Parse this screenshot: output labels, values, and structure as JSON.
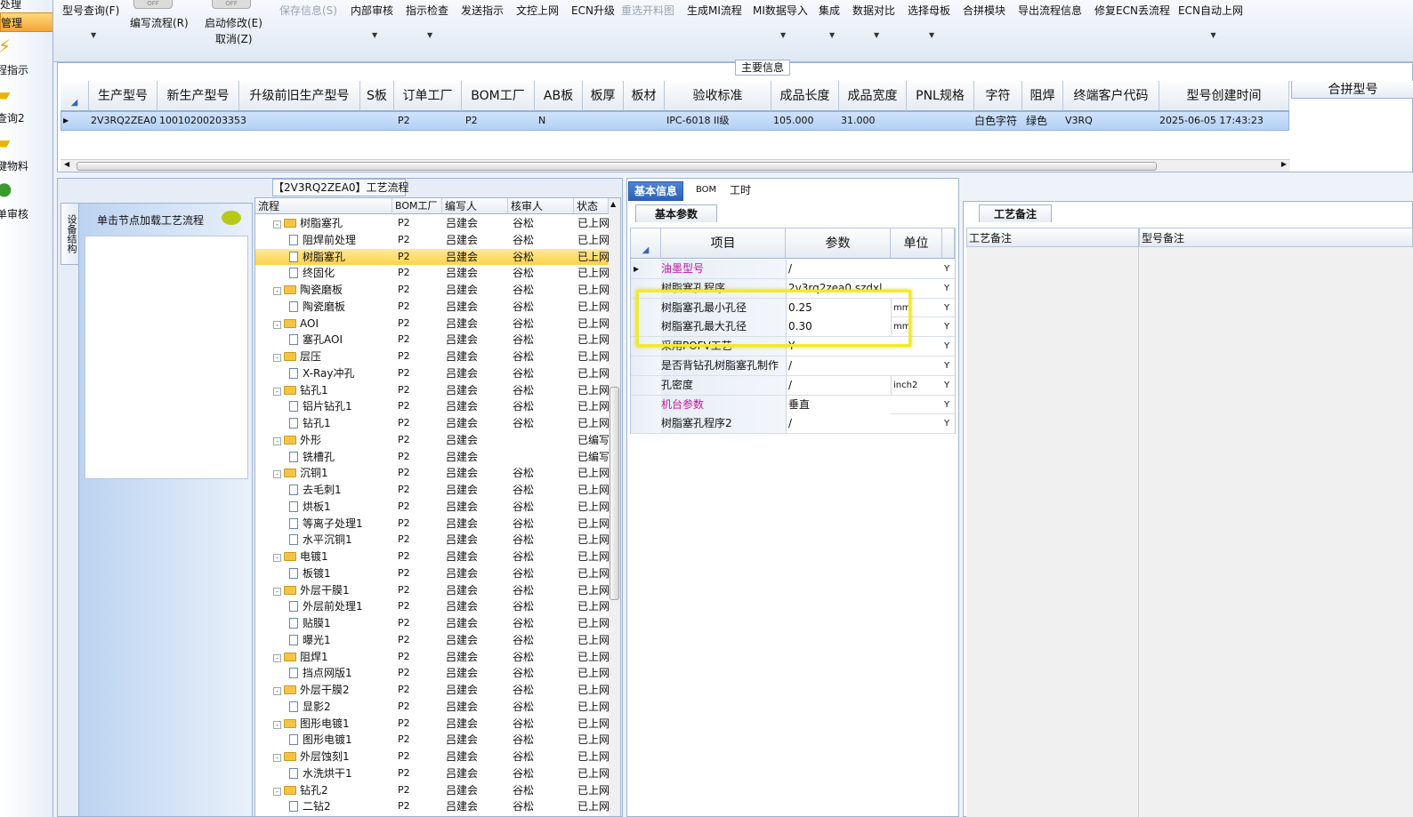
{
  "left_nav": {
    "top_item": "处理",
    "selected_item": "管理",
    "items": [
      "程指示",
      "查询2",
      "键物料",
      "单审核"
    ]
  },
  "toolbar": {
    "items": [
      {
        "label": "型号查询(F)",
        "enabled": true
      },
      {
        "label": "编写流程(R)",
        "enabled": true
      },
      {
        "label": "启动修改(E)",
        "enabled": true
      },
      {
        "label": "取消(Z)",
        "enabled": true
      },
      {
        "label": "保存信息(S)",
        "enabled": false
      },
      {
        "label": "内部审核",
        "enabled": true
      },
      {
        "label": "指示检查",
        "enabled": true
      },
      {
        "label": "发送指示",
        "enabled": true
      },
      {
        "label": "文控上网",
        "enabled": true
      },
      {
        "label": "ECN升级",
        "enabled": true
      },
      {
        "label": "重选开料图",
        "enabled": false
      },
      {
        "label": "生成MI流程",
        "enabled": true
      },
      {
        "label": "MI数据导入",
        "enabled": true
      },
      {
        "label": "集成",
        "enabled": true
      },
      {
        "label": "数据对比",
        "enabled": true
      },
      {
        "label": "选择母板",
        "enabled": true
      },
      {
        "label": "合拼模块",
        "enabled": true
      },
      {
        "label": "导出流程信息",
        "enabled": true
      },
      {
        "label": "修复ECN丢流程",
        "enabled": true
      },
      {
        "label": "ECN自动上网",
        "enabled": true
      }
    ],
    "toggle_label": "OFF"
  },
  "main_info": {
    "title": "主要信息",
    "columns": [
      "生产型号",
      "新生产型号",
      "升级前旧生产型号",
      "S板",
      "订单工厂",
      "BOM工厂",
      "AB板",
      "板厚",
      "板材",
      "验收标准",
      "成品长度",
      "成品宽度",
      "PNL规格",
      "字符",
      "阻焊",
      "终端客户代码",
      "型号创建时间"
    ],
    "row": [
      "2V3RQ2ZEA0",
      "10010200203353",
      "",
      "",
      "P2",
      "P2",
      "N",
      "",
      "",
      "IPC-6018 II级",
      "105.000",
      "31.000",
      "",
      "白色字符",
      "绿色",
      "V3RQ",
      "2025-06-05 17:43:23"
    ],
    "right_header": "合拼型号"
  },
  "flow_panel": {
    "title": "【2V3RQ2ZEA0】工艺流程",
    "side_tab": "设备结构",
    "side_hint": "单击节点加载工艺流程",
    "columns": [
      "流程",
      "BOM工厂",
      "编写人",
      "核审人",
      "状态"
    ],
    "rows": [
      {
        "name": "树脂塞孔",
        "level": 0,
        "bom": "P2",
        "writer": "吕建会",
        "reviewer": "谷松",
        "status": "已上网"
      },
      {
        "name": "阻焊前处理",
        "level": 1,
        "bom": "P2",
        "writer": "吕建会",
        "reviewer": "谷松",
        "status": "已上网"
      },
      {
        "name": "树脂塞孔",
        "level": 1,
        "bom": "P2",
        "writer": "吕建会",
        "reviewer": "谷松",
        "status": "已上网",
        "selected": true
      },
      {
        "name": "终固化",
        "level": 1,
        "bom": "P2",
        "writer": "吕建会",
        "reviewer": "谷松",
        "status": "已上网"
      },
      {
        "name": "陶瓷磨板",
        "level": 0,
        "bom": "P2",
        "writer": "吕建会",
        "reviewer": "谷松",
        "status": "已上网"
      },
      {
        "name": "陶瓷磨板",
        "level": 1,
        "bom": "P2",
        "writer": "吕建会",
        "reviewer": "谷松",
        "status": "已上网"
      },
      {
        "name": "AOI",
        "level": 0,
        "bom": "P2",
        "writer": "吕建会",
        "reviewer": "谷松",
        "status": "已上网"
      },
      {
        "name": "塞孔AOI",
        "level": 1,
        "bom": "P2",
        "writer": "吕建会",
        "reviewer": "谷松",
        "status": "已上网"
      },
      {
        "name": "层压",
        "level": 0,
        "bom": "P2",
        "writer": "吕建会",
        "reviewer": "谷松",
        "status": "已上网"
      },
      {
        "name": "X-Ray冲孔",
        "level": 1,
        "bom": "P2",
        "writer": "吕建会",
        "reviewer": "谷松",
        "status": "已上网"
      },
      {
        "name": "钻孔1",
        "level": 0,
        "bom": "P2",
        "writer": "吕建会",
        "reviewer": "谷松",
        "status": "已上网"
      },
      {
        "name": "铝片钻孔1",
        "level": 1,
        "bom": "P2",
        "writer": "吕建会",
        "reviewer": "谷松",
        "status": "已上网"
      },
      {
        "name": "钻孔1",
        "level": 1,
        "bom": "P2",
        "writer": "吕建会",
        "reviewer": "谷松",
        "status": "已上网"
      },
      {
        "name": "外形",
        "level": 0,
        "bom": "P2",
        "writer": "吕建会",
        "reviewer": "",
        "status": "已编写"
      },
      {
        "name": "铣槽孔",
        "level": 1,
        "bom": "P2",
        "writer": "吕建会",
        "reviewer": "",
        "status": "已编写"
      },
      {
        "name": "沉铜1",
        "level": 0,
        "bom": "P2",
        "writer": "吕建会",
        "reviewer": "谷松",
        "status": "已上网"
      },
      {
        "name": "去毛刺1",
        "level": 1,
        "bom": "P2",
        "writer": "吕建会",
        "reviewer": "谷松",
        "status": "已上网"
      },
      {
        "name": "烘板1",
        "level": 1,
        "bom": "P2",
        "writer": "吕建会",
        "reviewer": "谷松",
        "status": "已上网"
      },
      {
        "name": "等离子处理1",
        "level": 1,
        "bom": "P2",
        "writer": "吕建会",
        "reviewer": "谷松",
        "status": "已上网"
      },
      {
        "name": "水平沉铜1",
        "level": 1,
        "bom": "P2",
        "writer": "吕建会",
        "reviewer": "谷松",
        "status": "已上网"
      },
      {
        "name": "电镀1",
        "level": 0,
        "bom": "P2",
        "writer": "吕建会",
        "reviewer": "谷松",
        "status": "已上网"
      },
      {
        "name": "板镀1",
        "level": 1,
        "bom": "P2",
        "writer": "吕建会",
        "reviewer": "谷松",
        "status": "已上网"
      },
      {
        "name": "外层干膜1",
        "level": 0,
        "bom": "P2",
        "writer": "吕建会",
        "reviewer": "谷松",
        "status": "已上网"
      },
      {
        "name": "外层前处理1",
        "level": 1,
        "bom": "P2",
        "writer": "吕建会",
        "reviewer": "谷松",
        "status": "已上网"
      },
      {
        "name": "贴膜1",
        "level": 1,
        "bom": "P2",
        "writer": "吕建会",
        "reviewer": "谷松",
        "status": "已上网"
      },
      {
        "name": "曝光1",
        "level": 1,
        "bom": "P2",
        "writer": "吕建会",
        "reviewer": "谷松",
        "status": "已上网"
      },
      {
        "name": "阻焊1",
        "level": 0,
        "bom": "P2",
        "writer": "吕建会",
        "reviewer": "谷松",
        "status": "已上网"
      },
      {
        "name": "挡点网版1",
        "level": 1,
        "bom": "P2",
        "writer": "吕建会",
        "reviewer": "谷松",
        "status": "已上网"
      },
      {
        "name": "外层干膜2",
        "level": 0,
        "bom": "P2",
        "writer": "吕建会",
        "reviewer": "谷松",
        "status": "已上网"
      },
      {
        "name": "显影2",
        "level": 1,
        "bom": "P2",
        "writer": "吕建会",
        "reviewer": "谷松",
        "status": "已上网"
      },
      {
        "name": "图形电镀1",
        "level": 0,
        "bom": "P2",
        "writer": "吕建会",
        "reviewer": "谷松",
        "status": "已上网"
      },
      {
        "name": "图形电镀1",
        "level": 1,
        "bom": "P2",
        "writer": "吕建会",
        "reviewer": "谷松",
        "status": "已上网"
      },
      {
        "name": "外层蚀刻1",
        "level": 0,
        "bom": "P2",
        "writer": "吕建会",
        "reviewer": "谷松",
        "status": "已上网"
      },
      {
        "name": "水洗烘干1",
        "level": 1,
        "bom": "P2",
        "writer": "吕建会",
        "reviewer": "谷松",
        "status": "已上网"
      },
      {
        "name": "钻孔2",
        "level": 0,
        "bom": "P2",
        "writer": "吕建会",
        "reviewer": "谷松",
        "status": "已上网"
      },
      {
        "name": "二钻2",
        "level": 1,
        "bom": "P2",
        "writer": "吕建会",
        "reviewer": "谷松",
        "status": "已上网"
      }
    ]
  },
  "params_panel": {
    "tabs": [
      "基本信息",
      "BOM",
      "工时"
    ],
    "subtab": "基本参数",
    "columns": [
      "项目",
      "参数",
      "单位"
    ],
    "rows": [
      {
        "item": "油墨型号",
        "value": "/",
        "unit": "",
        "flag": "Y",
        "magenta": true,
        "current": true
      },
      {
        "item": "树脂塞孔程序",
        "value": "2v3rq2zea0.szdxl",
        "unit": "",
        "flag": "Y"
      },
      {
        "item": "树脂塞孔最小孔径",
        "value": "0.25",
        "unit": "mm",
        "flag": "Y"
      },
      {
        "item": "树脂塞孔最大孔径",
        "value": "0.30",
        "unit": "mm",
        "flag": "Y"
      },
      {
        "item": "采用POFV工艺",
        "value": "Y",
        "unit": "",
        "flag": "Y"
      },
      {
        "item": "是否背钻孔树脂塞孔制作",
        "value": "/",
        "unit": "",
        "flag": "Y"
      },
      {
        "item": "孔密度",
        "value": "/",
        "unit": "inch2",
        "flag": "Y"
      },
      {
        "item": "机台参数",
        "value": "垂直",
        "unit": "",
        "flag": "Y",
        "magenta": true
      },
      {
        "item": "树脂塞孔程序2",
        "value": "/",
        "unit": "",
        "flag": "Y"
      }
    ]
  },
  "remarks_panel": {
    "tab": "工艺备注",
    "col1": "工艺备注",
    "col2": "型号备注"
  }
}
